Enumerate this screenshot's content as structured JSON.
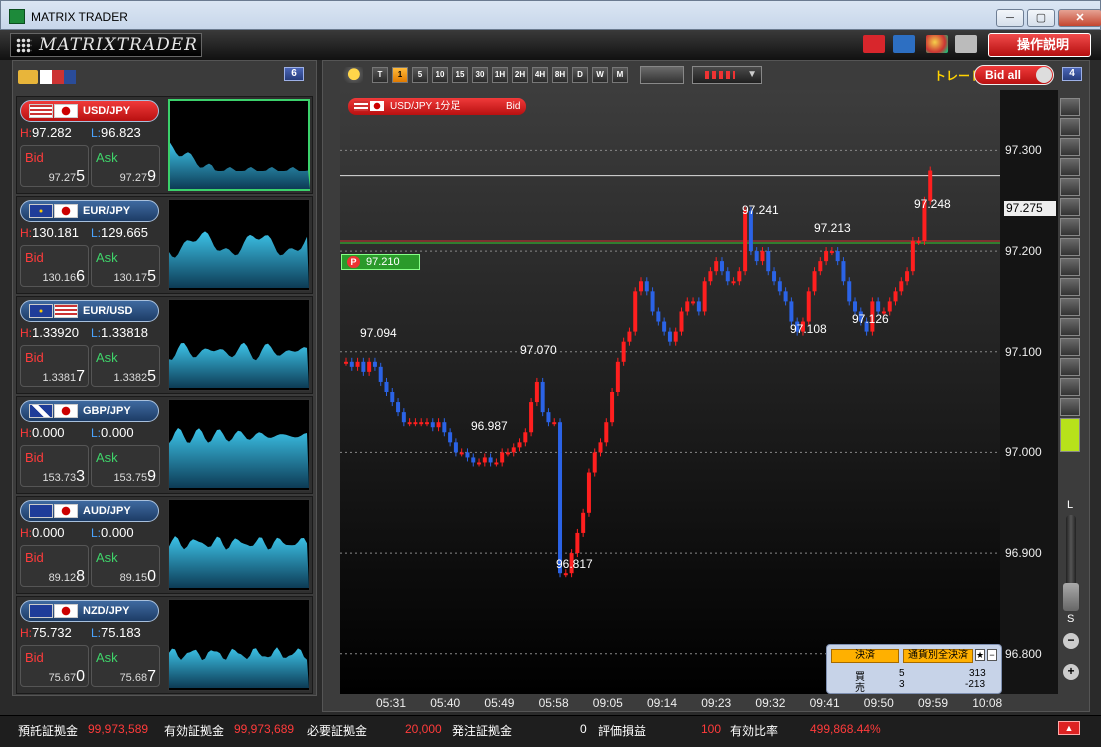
{
  "window": {
    "title": "MATRIX TRADER",
    "min": "─",
    "max": "▢",
    "close": "✕"
  },
  "app": {
    "logo": "MATRIXTRADER",
    "help": "操作説明"
  },
  "left": {
    "count": "6",
    "cards": [
      {
        "pair": "USD/JPY",
        "h": "97.282",
        "l": "96.823",
        "bid_lbl": "Bid",
        "ask_lbl": "Ask",
        "bid_a": "97.27",
        "bid_b": "5",
        "ask_a": "97.27",
        "ask_b": "9",
        "flag1": "us",
        "flag2": "jp",
        "active": true
      },
      {
        "pair": "EUR/JPY",
        "h": "130.181",
        "l": "129.665",
        "bid_lbl": "Bid",
        "ask_lbl": "Ask",
        "bid_a": "130.16",
        "bid_b": "6",
        "ask_a": "130.17",
        "ask_b": "5",
        "flag1": "eu",
        "flag2": "jp"
      },
      {
        "pair": "EUR/USD",
        "h": "1.33920",
        "l": "1.33818",
        "bid_lbl": "Bid",
        "ask_lbl": "Ask",
        "bid_a": "1.3381",
        "bid_b": "7",
        "ask_a": "1.3382",
        "ask_b": "5",
        "flag1": "eu",
        "flag2": "us"
      },
      {
        "pair": "GBP/JPY",
        "h": "0.000",
        "l": "0.000",
        "bid_lbl": "Bid",
        "ask_lbl": "Ask",
        "bid_a": "153.73",
        "bid_b": "3",
        "ask_a": "153.75",
        "ask_b": "9",
        "flag1": "gb",
        "flag2": "jp"
      },
      {
        "pair": "AUD/JPY",
        "h": "0.000",
        "l": "0.000",
        "bid_lbl": "Bid",
        "ask_lbl": "Ask",
        "bid_a": "89.12",
        "bid_b": "8",
        "ask_a": "89.15",
        "ask_b": "0",
        "flag1": "au",
        "flag2": "jp"
      },
      {
        "pair": "NZD/JPY",
        "h": "75.732",
        "l": "75.183",
        "bid_lbl": "Bid",
        "ask_lbl": "Ask",
        "bid_a": "75.67",
        "bid_b": "0",
        "ask_a": "75.68",
        "ask_b": "7",
        "flag1": "nz",
        "flag2": "jp"
      }
    ],
    "hlabel": "H:",
    "llabel": "L:"
  },
  "toolbar": {
    "timeframes": [
      "T",
      "1",
      "5",
      "10",
      "15",
      "30",
      "1H",
      "2H",
      "4H",
      "8H",
      "D",
      "W",
      "M"
    ],
    "active": "1",
    "trade": "トレード",
    "bid_all": "Bid all",
    "chart_count": "4"
  },
  "chart": {
    "pair_label": "USD/JPY 1分足",
    "side": "Bid",
    "current": "97.275",
    "position": "97.210",
    "yticks": [
      "97.300",
      "97.200",
      "97.100",
      "97.000",
      "96.900",
      "96.800"
    ],
    "xticks": [
      "05:31",
      "05:40",
      "05:49",
      "05:58",
      "09:05",
      "09:14",
      "09:23",
      "09:32",
      "09:41",
      "09:50",
      "09:59",
      "10:08"
    ],
    "annotations": [
      "97.094",
      "96.987",
      "97.070",
      "96.817",
      "97.241",
      "97.213",
      "97.108",
      "97.126",
      "97.248"
    ],
    "zoom_l": "L",
    "zoom_s": "S"
  },
  "order": {
    "settle": "決済",
    "all_settle": "通貨別全決済",
    "buy": "買",
    "sell": "売",
    "buy_qty": "5",
    "sell_qty": "3",
    "buy_pl": "313",
    "sell_pl": "-213"
  },
  "status": {
    "deposit_lbl": "預託証拠金",
    "deposit": "99,973,589",
    "effective_lbl": "有効証拠金",
    "effective": "99,973,689",
    "required_lbl": "必要証拠金",
    "required": "20,000",
    "order_lbl": "発注証拠金",
    "order": "0",
    "eval_lbl": "評価損益",
    "eval": "100",
    "ratio_lbl": "有効比率",
    "ratio": "499,868.44%"
  },
  "chart_data": {
    "type": "candlestick",
    "ylim": [
      96.76,
      97.36
    ],
    "yticks": [
      97.3,
      97.2,
      97.1,
      97.0,
      96.9,
      96.8
    ],
    "current": 97.275,
    "position": 97.21,
    "candles": [
      97.09,
      97.085,
      97.09,
      97.08,
      97.09,
      97.085,
      97.07,
      97.06,
      97.05,
      97.04,
      97.03,
      97.03,
      97.03,
      97.03,
      97.03,
      97.025,
      97.03,
      97.02,
      97.01,
      97.0,
      97.0,
      96.995,
      96.99,
      96.99,
      96.995,
      96.99,
      96.99,
      97.0,
      97.0,
      97.005,
      97.01,
      97.02,
      97.05,
      97.07,
      97.04,
      97.03,
      97.03,
      96.88,
      96.88,
      96.9,
      96.92,
      96.94,
      96.98,
      97.0,
      97.01,
      97.03,
      97.06,
      97.09,
      97.11,
      97.12,
      97.16,
      97.17,
      97.16,
      97.14,
      97.13,
      97.12,
      97.11,
      97.12,
      97.14,
      97.15,
      97.15,
      97.14,
      97.17,
      97.18,
      97.19,
      97.18,
      97.17,
      97.17,
      97.18,
      97.24,
      97.2,
      97.19,
      97.2,
      97.18,
      97.17,
      97.16,
      97.15,
      97.13,
      97.12,
      97.13,
      97.16,
      97.18,
      97.19,
      97.2,
      97.2,
      97.19,
      97.17,
      97.15,
      97.14,
      97.13,
      97.12,
      97.15,
      97.14,
      97.14,
      97.15,
      97.16,
      97.17,
      97.18,
      97.21,
      97.21,
      97.25,
      97.28
    ]
  }
}
